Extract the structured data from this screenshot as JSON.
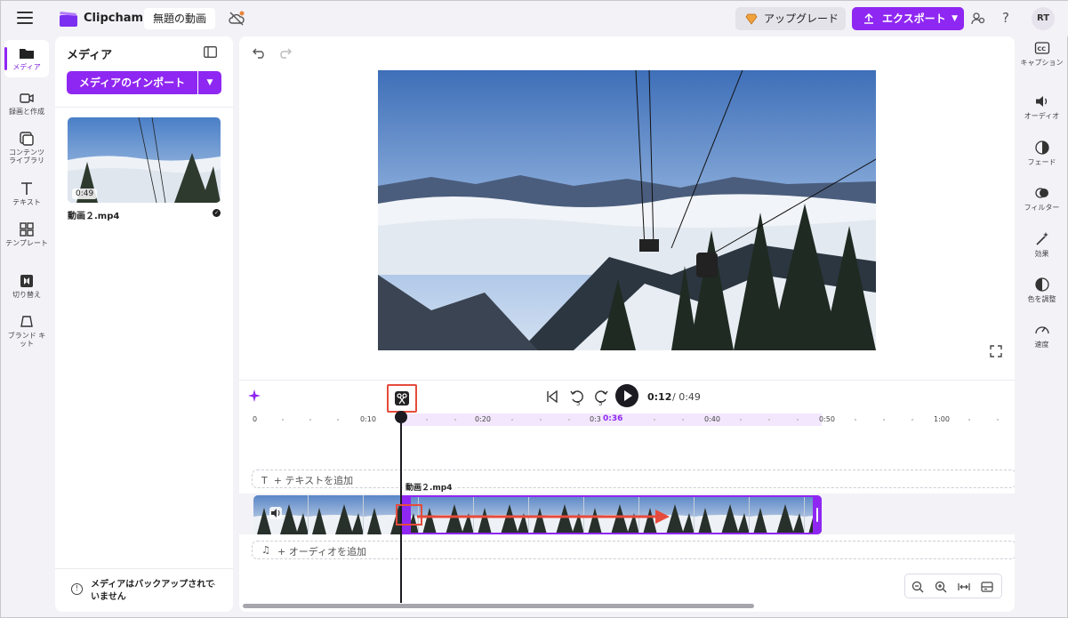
{
  "topbar": {
    "app_name": "Clipchamp",
    "project_title": "無題の動画",
    "upgrade_label": "アップグレード",
    "export_label": "エクスポート",
    "avatar_initials": "RT",
    "help_label": "?"
  },
  "leftnav": {
    "items": [
      {
        "label": "メディア",
        "icon": "folder-icon"
      },
      {
        "label": "録画と作成",
        "icon": "camera-icon"
      },
      {
        "label": "コンテンツ ライブラリ",
        "icon": "library-icon"
      },
      {
        "label": "テキスト",
        "icon": "text-icon"
      },
      {
        "label": "テンプレート",
        "icon": "template-icon"
      },
      {
        "label": "切り替え",
        "icon": "transition-icon"
      },
      {
        "label": "ブランド キット",
        "icon": "brand-kit-icon"
      }
    ]
  },
  "media_panel": {
    "title": "メディア",
    "import_label": "メディアのインポート",
    "clip": {
      "duration": "0:49",
      "name": "動画２.mp4"
    },
    "backup_notice": "メディアはバックアップされていません"
  },
  "player": {
    "current_time": "0:12",
    "total_time": "/ 0:49"
  },
  "ruler": {
    "ticks": [
      "0",
      "0:10",
      "0:20",
      "0:3",
      "0:36",
      "0:40",
      "0:50",
      "1:00"
    ]
  },
  "timeline": {
    "text_track_label": "+ テキストを追加",
    "text_track_icon": "T",
    "clip_label": "動画２.mp4",
    "audio_track_label": "+ オーディオを追加",
    "audio_track_icon": "♫"
  },
  "rightnav": {
    "items": [
      {
        "label": "キャプション",
        "icon": "captions-icon"
      },
      {
        "label": "オーディオ",
        "icon": "speaker-icon"
      },
      {
        "label": "フェード",
        "icon": "fade-icon"
      },
      {
        "label": "フィルター",
        "icon": "filter-icon"
      },
      {
        "label": "効果",
        "icon": "effects-wand-icon"
      },
      {
        "label": "色を調整",
        "icon": "color-adjust-icon"
      },
      {
        "label": "速度",
        "icon": "speed-icon"
      }
    ]
  },
  "colors": {
    "accent": "#8f27f2",
    "annotation_red": "#e54b3c",
    "background": "#f3f2f7"
  }
}
